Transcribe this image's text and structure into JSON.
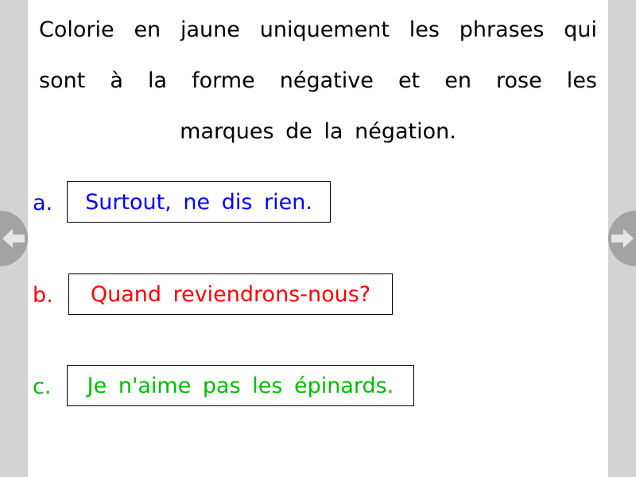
{
  "instruction": "Colorie en jaune uniquement les phrases qui sont à la forme négative et en rose les marques de la négation.",
  "items": [
    {
      "letter": "a.",
      "sentence": "Surtout, ne dis rien.",
      "color": "#0000ff"
    },
    {
      "letter": "b.",
      "sentence": "Quand reviendrons-nous?",
      "color": "#ff0000"
    },
    {
      "letter": "c.",
      "sentence": "Je n'aime pas les épinards.",
      "color": "#00bb00"
    }
  ],
  "navigation": {
    "prev_icon": "arrow-left-icon",
    "next_icon": "arrow-right-icon"
  },
  "colors": {
    "background": "#d3d3d3",
    "page": "#ffffff",
    "nav_button": "#a3a3a3",
    "nav_arrow": "#e6e6e6"
  }
}
